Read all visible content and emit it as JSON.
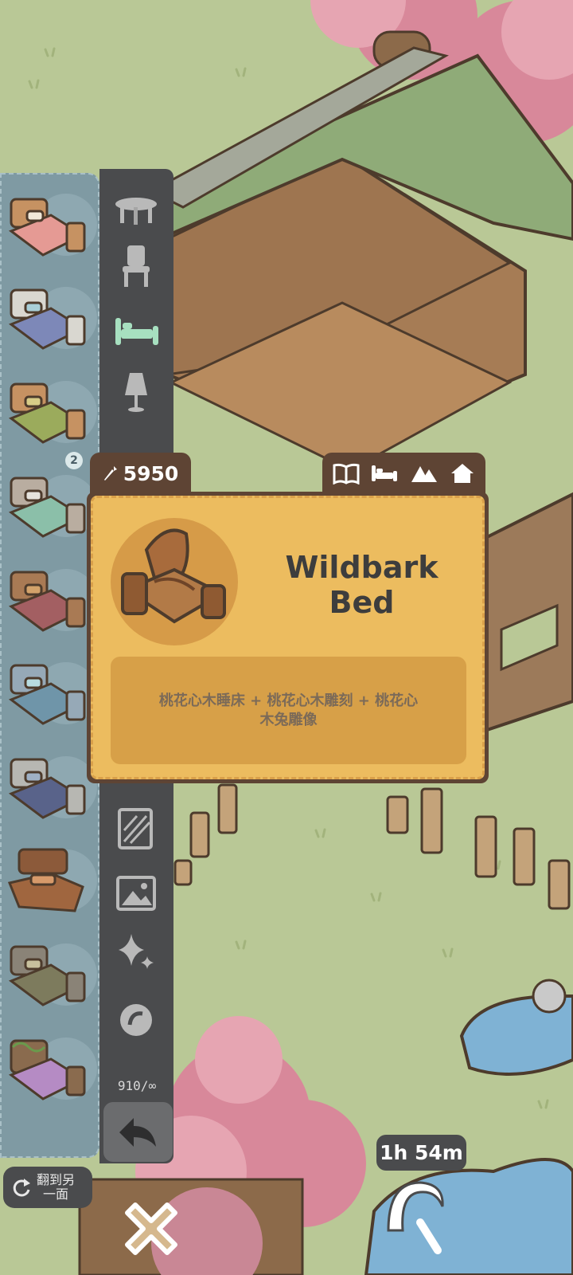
{
  "price": {
    "icon": "carrot-icon",
    "value": "5950"
  },
  "tags": [
    "book-icon",
    "bed-icon",
    "mountain-icon",
    "home-icon"
  ],
  "item": {
    "name": "Wildbark Bed",
    "description": "桃花心木睡床 + 桃花心木雕刻 + 桃花心木兔雕像"
  },
  "item_list": {
    "badge_count": "2",
    "items": [
      "pink-bed-icon",
      "blue-bed-icon",
      "green-bed-icon",
      "mint-bed-icon",
      "maroon-bed-icon",
      "striped-bed-icon",
      "navy-bed-icon",
      "boat-bed-icon",
      "olive-bed-icon",
      "vine-bed-icon"
    ]
  },
  "categories": [
    "table-icon",
    "chair-icon",
    "bed-icon",
    "lamp-icon",
    "rug-icon",
    "wallpaper-icon",
    "picture-icon",
    "sparkle-icon",
    "special-icon"
  ],
  "capacity": "910/∞",
  "flip_button": {
    "label_line1": "翻到另",
    "label_line2": "一面"
  },
  "timer": "1h 54m",
  "colors": {
    "card": "#ecbc5f",
    "frame": "#5e4434",
    "panel": "#4a4b4d",
    "list": "#7f9aa3",
    "active_category": "#a7e0c0"
  }
}
